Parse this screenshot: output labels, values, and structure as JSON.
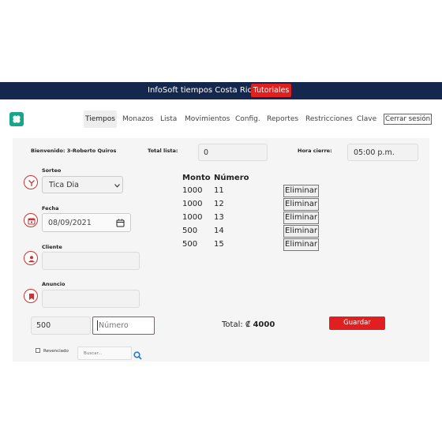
{
  "header": {
    "title": "InfoSoft tiempos Costa Rica",
    "tutorials_label": "Tutoriales"
  },
  "nav": {
    "items": [
      "Tiempos",
      "Monazos",
      "Lista",
      "Movimientos",
      "Config.",
      "Reportes",
      "Restricciones",
      "Clave"
    ],
    "logout_label": "Cerrar sesión"
  },
  "info": {
    "welcome": "Bienvenido: 3-Roberto Quiros",
    "total_lista_label": "Total lista:",
    "total_lista_value": "0",
    "hora_cierre_label": "Hora cierre:",
    "hora_cierre_value": "05:00 p.m."
  },
  "form": {
    "sorteo_label": "Sorteo",
    "sorteo_value": "Tica Dia",
    "fecha_label": "Fecha",
    "fecha_value": "08/09/2021",
    "cliente_label": "Cliente",
    "anuncio_label": "Anuncio"
  },
  "table": {
    "headers": [
      "Monto",
      "Número"
    ],
    "rows": [
      {
        "monto": "1000",
        "numero": "11"
      },
      {
        "monto": "1000",
        "numero": "12"
      },
      {
        "monto": "1000",
        "numero": "13"
      },
      {
        "monto": "500",
        "numero": "14"
      },
      {
        "monto": "500",
        "numero": "15"
      }
    ],
    "delete_label": "Eliminar"
  },
  "entry": {
    "amount_value": "500",
    "numero_placeholder": "Número",
    "total_prefix": "Total: ₡",
    "total_value": "4000",
    "save_label": "Guardar"
  },
  "footer": {
    "revenciado_label": "Revenciado",
    "search_placeholder": "Buscar..."
  },
  "colors": {
    "navy": "#13284c",
    "accent_red": "#e02020",
    "logo_teal": "#17a58b"
  }
}
